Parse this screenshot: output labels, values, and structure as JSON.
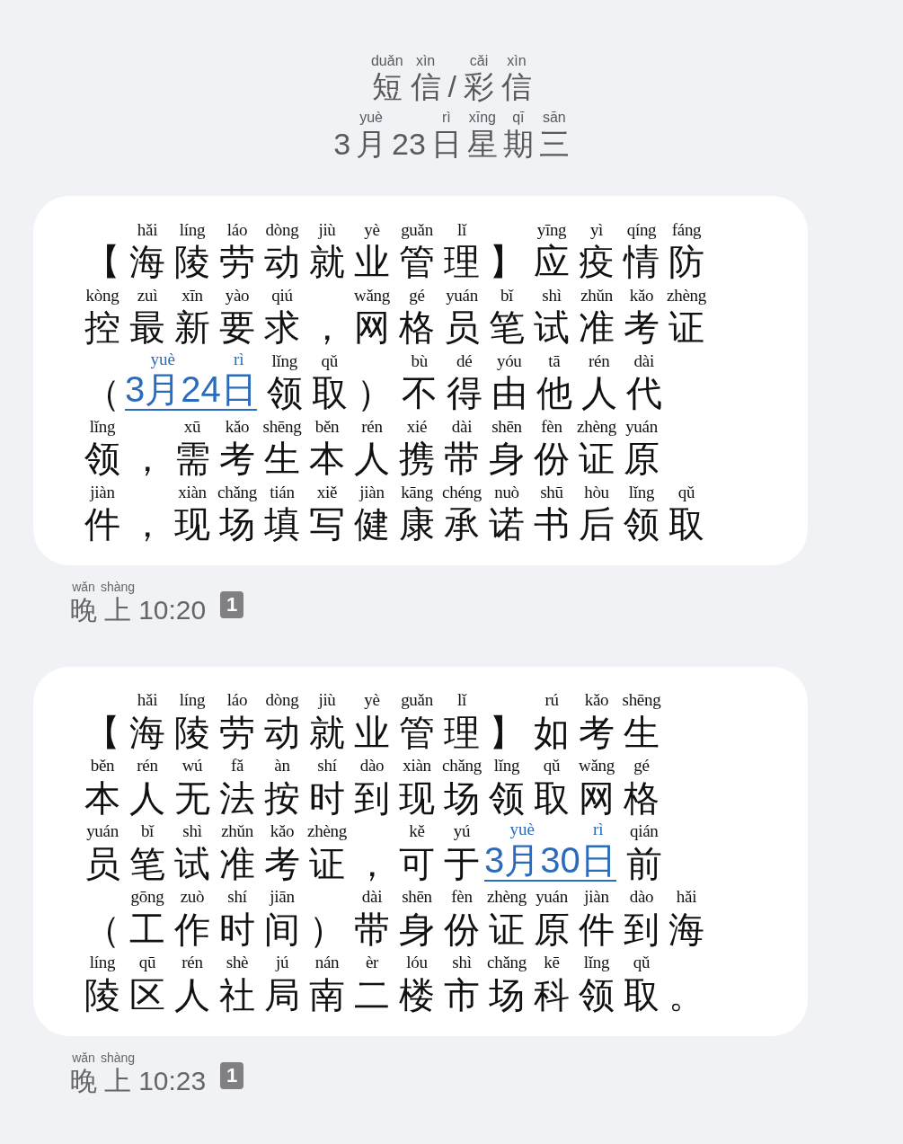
{
  "header": {
    "title": [
      {
        "c": "短",
        "py": "duǎn"
      },
      {
        "c": "信",
        "py": "xìn"
      },
      {
        "c": "/"
      },
      {
        "c": "彩",
        "py": "cǎi"
      },
      {
        "c": "信",
        "py": "xìn"
      }
    ],
    "date": [
      {
        "c": "3"
      },
      {
        "c": "月",
        "py": "yuè"
      },
      {
        "c": "23"
      },
      {
        "c": "日",
        "py": "rì"
      },
      {
        "c": "星",
        "py": "xīng"
      },
      {
        "c": "期",
        "py": "qī"
      },
      {
        "c": "三",
        "py": "sān"
      }
    ]
  },
  "messages": [
    {
      "lines": [
        [
          {
            "c": "【"
          },
          {
            "c": "海",
            "py": "hǎi"
          },
          {
            "c": "陵",
            "py": "líng"
          },
          {
            "c": "劳",
            "py": "láo"
          },
          {
            "c": "动",
            "py": "dòng"
          },
          {
            "c": "就",
            "py": "jiù"
          },
          {
            "c": "业",
            "py": "yè"
          },
          {
            "c": "管",
            "py": "guǎn"
          },
          {
            "c": "理",
            "py": "lǐ"
          },
          {
            "c": "】"
          },
          {
            "c": "应",
            "py": "yīng"
          },
          {
            "c": "疫",
            "py": "yì"
          },
          {
            "c": "情",
            "py": "qíng"
          },
          {
            "c": "防",
            "py": "fáng"
          }
        ],
        [
          {
            "c": "控",
            "py": "kòng"
          },
          {
            "c": "最",
            "py": "zuì"
          },
          {
            "c": "新",
            "py": "xīn"
          },
          {
            "c": "要",
            "py": "yào"
          },
          {
            "c": "求",
            "py": "qiú"
          },
          {
            "c": "，"
          },
          {
            "c": "网",
            "py": "wǎng"
          },
          {
            "c": "格",
            "py": "gé"
          },
          {
            "c": "员",
            "py": "yuán"
          },
          {
            "c": "笔",
            "py": "bǐ"
          },
          {
            "c": "试",
            "py": "shì"
          },
          {
            "c": "准",
            "py": "zhǔn"
          },
          {
            "c": "考",
            "py": "kǎo"
          },
          {
            "c": "证",
            "py": "zhèng"
          }
        ],
        [
          {
            "c": "（"
          },
          {
            "kind": "link",
            "parts": [
              {
                "c": "3"
              },
              {
                "c": "月",
                "py": "yuè"
              },
              {
                "c": "24"
              },
              {
                "c": "日",
                "py": "rì"
              }
            ]
          },
          {
            "c": "领",
            "py": "lǐng"
          },
          {
            "c": "取",
            "py": "qǔ"
          },
          {
            "c": "）"
          },
          {
            "c": "不",
            "py": "bù"
          },
          {
            "c": "得",
            "py": "dé"
          },
          {
            "c": "由",
            "py": "yóu"
          },
          {
            "c": "他",
            "py": "tā"
          },
          {
            "c": "人",
            "py": "rén"
          },
          {
            "c": "代",
            "py": "dài"
          }
        ],
        [
          {
            "c": "领",
            "py": "lǐng"
          },
          {
            "c": "，"
          },
          {
            "c": "需",
            "py": "xū"
          },
          {
            "c": "考",
            "py": "kǎo"
          },
          {
            "c": "生",
            "py": "shēng"
          },
          {
            "c": "本",
            "py": "běn"
          },
          {
            "c": "人",
            "py": "rén"
          },
          {
            "c": "携",
            "py": "xié"
          },
          {
            "c": "带",
            "py": "dài"
          },
          {
            "c": "身",
            "py": "shēn"
          },
          {
            "c": "份",
            "py": "fèn"
          },
          {
            "c": "证",
            "py": "zhèng"
          },
          {
            "c": "原",
            "py": "yuán"
          }
        ],
        [
          {
            "c": "件",
            "py": "jiàn"
          },
          {
            "c": "，"
          },
          {
            "c": "现",
            "py": "xiàn"
          },
          {
            "c": "场",
            "py": "chǎng"
          },
          {
            "c": "填",
            "py": "tián"
          },
          {
            "c": "写",
            "py": "xiě"
          },
          {
            "c": "健",
            "py": "jiàn"
          },
          {
            "c": "康",
            "py": "kāng"
          },
          {
            "c": "承",
            "py": "chéng"
          },
          {
            "c": "诺",
            "py": "nuò"
          },
          {
            "c": "书",
            "py": "shū"
          },
          {
            "c": "后",
            "py": "hòu"
          },
          {
            "c": "领",
            "py": "lǐng"
          },
          {
            "c": "取",
            "py": "qǔ"
          }
        ]
      ],
      "time": [
        {
          "c": "晚",
          "py": "wǎn"
        },
        {
          "c": "上",
          "py": "shàng"
        },
        {
          "c": "10:20"
        }
      ],
      "sim": "1"
    },
    {
      "lines": [
        [
          {
            "c": "【"
          },
          {
            "c": "海",
            "py": "hǎi"
          },
          {
            "c": "陵",
            "py": "líng"
          },
          {
            "c": "劳",
            "py": "láo"
          },
          {
            "c": "动",
            "py": "dòng"
          },
          {
            "c": "就",
            "py": "jiù"
          },
          {
            "c": "业",
            "py": "yè"
          },
          {
            "c": "管",
            "py": "guǎn"
          },
          {
            "c": "理",
            "py": "lǐ"
          },
          {
            "c": "】"
          },
          {
            "c": "如",
            "py": "rú"
          },
          {
            "c": "考",
            "py": "kǎo"
          },
          {
            "c": "生",
            "py": "shēng"
          }
        ],
        [
          {
            "c": "本",
            "py": "běn"
          },
          {
            "c": "人",
            "py": "rén"
          },
          {
            "c": "无",
            "py": "wú"
          },
          {
            "c": "法",
            "py": "fǎ"
          },
          {
            "c": "按",
            "py": "àn"
          },
          {
            "c": "时",
            "py": "shí"
          },
          {
            "c": "到",
            "py": "dào"
          },
          {
            "c": "现",
            "py": "xiàn"
          },
          {
            "c": "场",
            "py": "chǎng"
          },
          {
            "c": "领",
            "py": "lǐng"
          },
          {
            "c": "取",
            "py": "qǔ"
          },
          {
            "c": "网",
            "py": "wǎng"
          },
          {
            "c": "格",
            "py": "gé"
          }
        ],
        [
          {
            "c": "员",
            "py": "yuán"
          },
          {
            "c": "笔",
            "py": "bǐ"
          },
          {
            "c": "试",
            "py": "shì"
          },
          {
            "c": "准",
            "py": "zhǔn"
          },
          {
            "c": "考",
            "py": "kǎo"
          },
          {
            "c": "证",
            "py": "zhèng"
          },
          {
            "c": "，"
          },
          {
            "c": "可",
            "py": "kě"
          },
          {
            "c": "于",
            "py": "yú"
          },
          {
            "kind": "link",
            "parts": [
              {
                "c": "3"
              },
              {
                "c": "月",
                "py": "yuè"
              },
              {
                "c": "30"
              },
              {
                "c": "日",
                "py": "rì"
              }
            ]
          },
          {
            "c": "前",
            "py": "qián"
          }
        ],
        [
          {
            "c": "（"
          },
          {
            "c": "工",
            "py": "gōng"
          },
          {
            "c": "作",
            "py": "zuò"
          },
          {
            "c": "时",
            "py": "shí"
          },
          {
            "c": "间",
            "py": "jiān"
          },
          {
            "c": "）"
          },
          {
            "c": "带",
            "py": "dài"
          },
          {
            "c": "身",
            "py": "shēn"
          },
          {
            "c": "份",
            "py": "fèn"
          },
          {
            "c": "证",
            "py": "zhèng"
          },
          {
            "c": "原",
            "py": "yuán"
          },
          {
            "c": "件",
            "py": "jiàn"
          },
          {
            "c": "到",
            "py": "dào"
          },
          {
            "c": "海",
            "py": "hǎi"
          }
        ],
        [
          {
            "c": "陵",
            "py": "líng"
          },
          {
            "c": "区",
            "py": "qū"
          },
          {
            "c": "人",
            "py": "rén"
          },
          {
            "c": "社",
            "py": "shè"
          },
          {
            "c": "局",
            "py": "jú"
          },
          {
            "c": "南",
            "py": "nán"
          },
          {
            "c": "二",
            "py": "èr"
          },
          {
            "c": "楼",
            "py": "lóu"
          },
          {
            "c": "市",
            "py": "shì"
          },
          {
            "c": "场",
            "py": "chǎng"
          },
          {
            "c": "科",
            "py": "kē"
          },
          {
            "c": "领",
            "py": "lǐng"
          },
          {
            "c": "取",
            "py": "qǔ"
          },
          {
            "c": "。"
          }
        ]
      ],
      "time": [
        {
          "c": "晚",
          "py": "wǎn"
        },
        {
          "c": "上",
          "py": "shàng"
        },
        {
          "c": "10:23"
        }
      ],
      "sim": "1"
    }
  ]
}
